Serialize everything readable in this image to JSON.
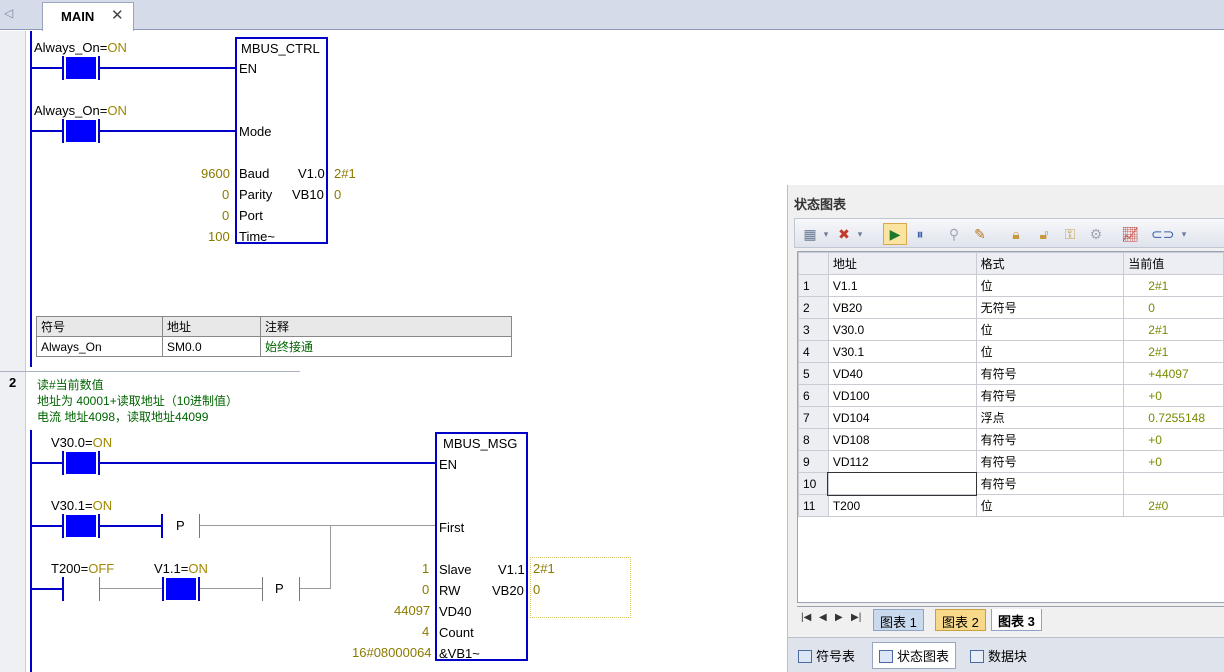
{
  "tab": {
    "label": "MAIN",
    "close": "✕"
  },
  "network1": {
    "contact1": {
      "name": "Always_On=",
      "state": "ON"
    },
    "contact2": {
      "name": "Always_On=",
      "state": "ON"
    },
    "block": {
      "title": "MBUS_CTRL",
      "pins_in": [
        "EN",
        "Mode",
        "Baud",
        "Parity",
        "Port",
        "Time~"
      ],
      "pins_out": [
        "V1.0",
        "VB10"
      ],
      "values_in": [
        "9600",
        "0",
        "0",
        "100"
      ],
      "values_out": [
        "2#1",
        "0"
      ]
    },
    "symtable": {
      "headers": [
        "符号",
        "地址",
        "注释"
      ],
      "row": [
        "Always_On",
        "SM0.0",
        "始终接通"
      ]
    }
  },
  "network2": {
    "number": "2",
    "comment": [
      "读#当前数值",
      "地址为 40001+读取地址（10进制值）",
      "电流 地址4098，读取地址44099"
    ],
    "contact1": {
      "name": "V30.0=",
      "state": "ON"
    },
    "contact2": {
      "name": "V30.1=",
      "state": "ON"
    },
    "contact3": {
      "name": "T200=",
      "state": "OFF"
    },
    "contact4": {
      "name": "V1.1=",
      "state": "ON"
    },
    "p_label": "P",
    "block": {
      "title": "MBUS_MSG",
      "pins_in": [
        "EN",
        "First",
        "Slave",
        "RW",
        "VD40",
        "Count",
        "&VB1~"
      ],
      "pins_out": [
        "V1.1",
        "VB20"
      ],
      "values_in": [
        "1",
        "0",
        "44097",
        "4",
        "16#08000064"
      ],
      "values_out": [
        "2#1",
        "0"
      ]
    }
  },
  "status_chart": {
    "title": "状态图表",
    "headers": [
      "",
      "地址",
      "格式",
      "当前值"
    ],
    "rows": [
      [
        "1",
        "V1.1",
        "位",
        "2#1"
      ],
      [
        "2",
        "VB20",
        "无符号",
        "0"
      ],
      [
        "3",
        "V30.0",
        "位",
        "2#1"
      ],
      [
        "4",
        "V30.1",
        "位",
        "2#1"
      ],
      [
        "5",
        "VD40",
        "有符号",
        "+44097"
      ],
      [
        "6",
        "VD100",
        "有符号",
        "+0"
      ],
      [
        "7",
        "VD104",
        "浮点",
        "0.7255148"
      ],
      [
        "8",
        "VD108",
        "有符号",
        "+0"
      ],
      [
        "9",
        "VD112",
        "有符号",
        "+0"
      ],
      [
        "10",
        "",
        "有符号",
        ""
      ],
      [
        "11",
        "T200",
        "位",
        "2#0"
      ]
    ],
    "sheet_tabs": [
      "图表 1",
      "图表 2",
      "图表 3"
    ],
    "bottom_tabs": [
      "符号表",
      "状态图表",
      "数据块"
    ]
  }
}
